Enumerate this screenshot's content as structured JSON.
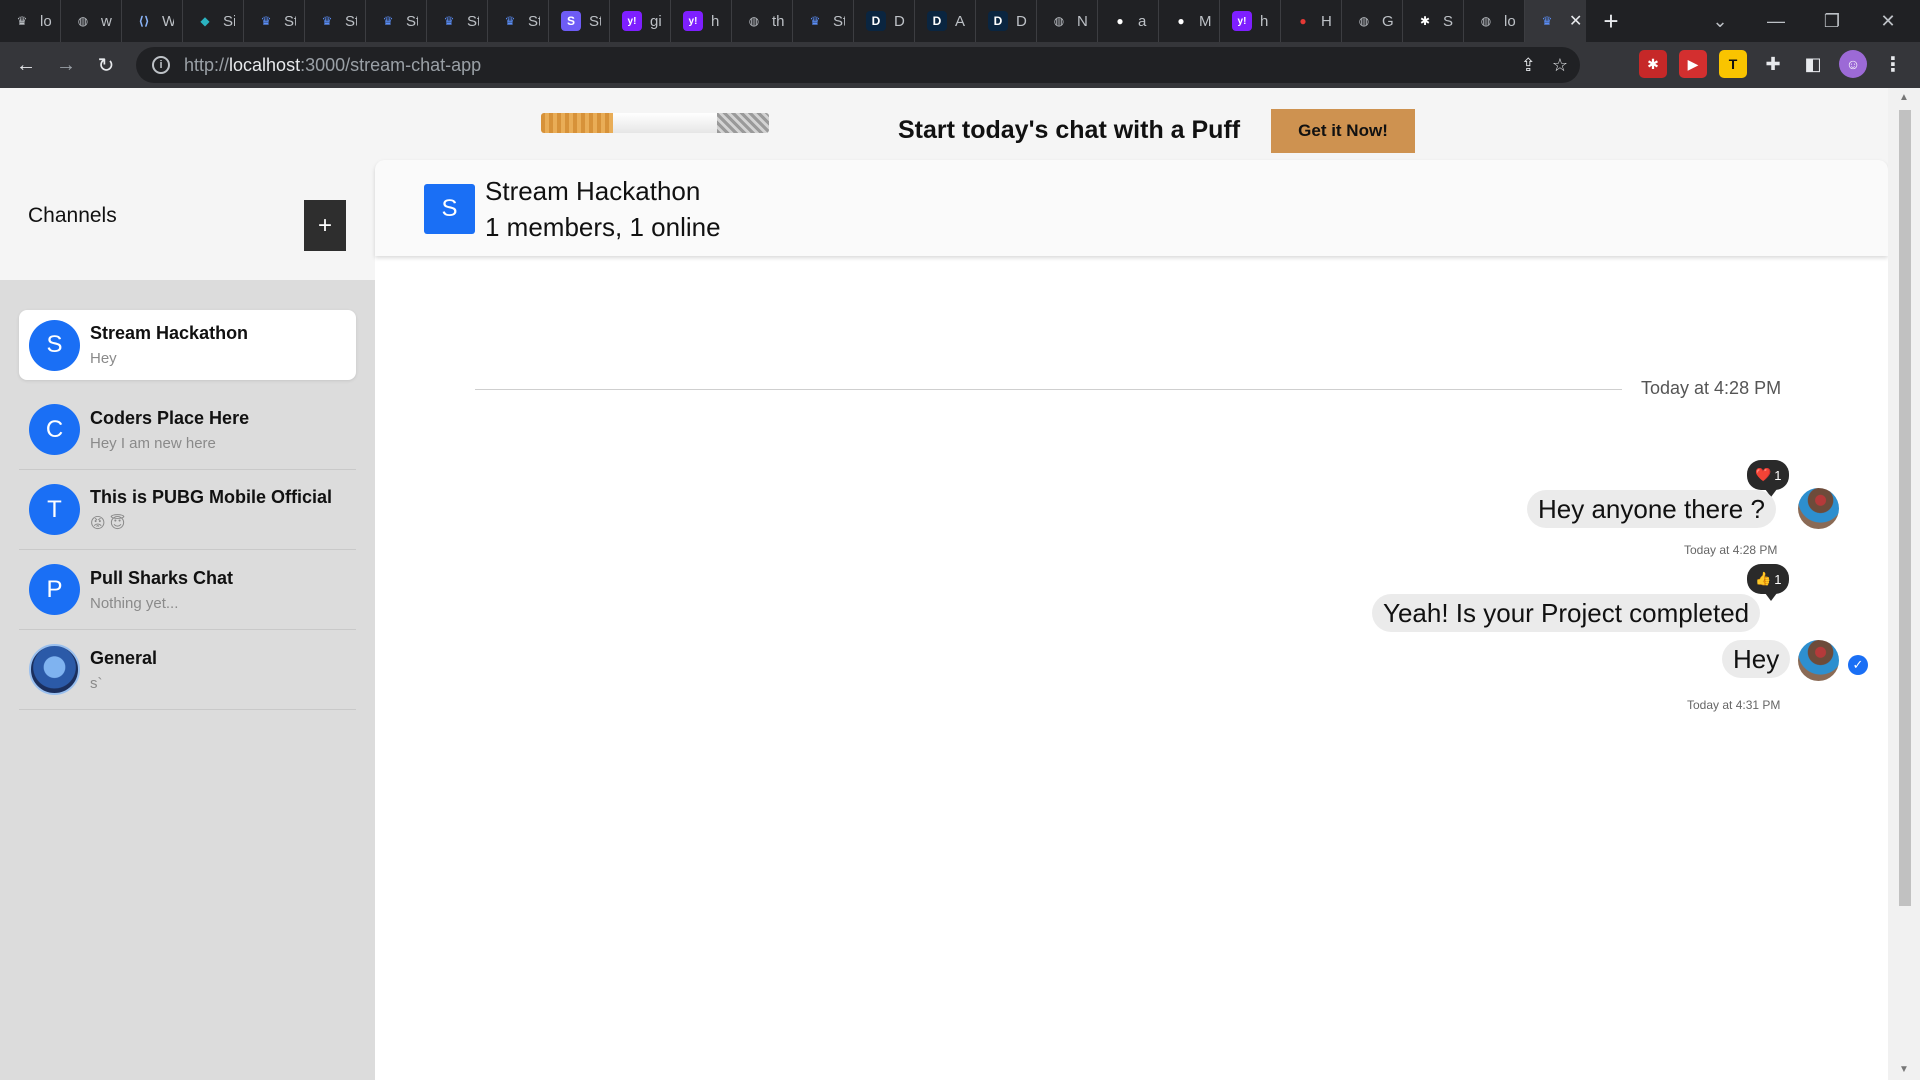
{
  "browser": {
    "tabs": [
      {
        "label": "lo",
        "icon": "vue-logo-icon",
        "color": "#bdc1c6"
      },
      {
        "label": "w",
        "icon": "globe-icon",
        "color": "#bdc1c6"
      },
      {
        "label": "W",
        "icon": "web-logo-icon",
        "color": "#8ab4f8"
      },
      {
        "label": "Si",
        "icon": "diamond-icon",
        "color": "#2bb3c0"
      },
      {
        "label": "St",
        "icon": "vue-logo-icon",
        "color": "#5b8ff9"
      },
      {
        "label": "St",
        "icon": "vue-logo-icon",
        "color": "#5b8ff9"
      },
      {
        "label": "St",
        "icon": "vue-logo-icon",
        "color": "#5b8ff9"
      },
      {
        "label": "St",
        "icon": "vue-logo-icon",
        "color": "#5b8ff9"
      },
      {
        "label": "St",
        "icon": "vue-logo-icon",
        "color": "#5b8ff9"
      },
      {
        "label": "St",
        "icon": "stream-s-icon",
        "color": "#6e5cf6"
      },
      {
        "label": "gi",
        "icon": "yahoo-icon",
        "color": "#7e1fff"
      },
      {
        "label": "h",
        "icon": "yahoo-icon",
        "color": "#7e1fff"
      },
      {
        "label": "th",
        "icon": "globe-icon",
        "color": "#bdc1c6"
      },
      {
        "label": "St",
        "icon": "vue-logo-icon",
        "color": "#5b8ff9"
      },
      {
        "label": "D",
        "icon": "d-letter-icon",
        "color": "#0a2540"
      },
      {
        "label": "A",
        "icon": "d-letter-icon",
        "color": "#0a2540"
      },
      {
        "label": "D",
        "icon": "d-letter-icon",
        "color": "#0a2540"
      },
      {
        "label": "N",
        "icon": "globe-icon",
        "color": "#bdc1c6"
      },
      {
        "label": "a",
        "icon": "github-icon",
        "color": "#ffffff"
      },
      {
        "label": "M",
        "icon": "github-icon",
        "color": "#ffffff"
      },
      {
        "label": "h",
        "icon": "yahoo-icon",
        "color": "#7e1fff"
      },
      {
        "label": "H",
        "icon": "record-icon",
        "color": "#e53935"
      },
      {
        "label": "G",
        "icon": "globe-icon",
        "color": "#bdc1c6"
      },
      {
        "label": "S",
        "icon": "gear-icon",
        "color": "#ffffff"
      },
      {
        "label": "lo",
        "icon": "globe-icon",
        "color": "#bdc1c6"
      }
    ],
    "active_tab_icon": "vue-logo-icon",
    "url_prefix": "http://",
    "url_host": "localhost",
    "url_rest": ":3000/stream-chat-app"
  },
  "banner": {
    "text": "Start today's chat with a Puff",
    "button": "Get it Now!"
  },
  "sidebar": {
    "title": "Channels",
    "add_label": "+",
    "channels": [
      {
        "initial": "S",
        "name": "Stream Hackathon",
        "preview": "Hey",
        "active": true
      },
      {
        "initial": "C",
        "name": "Coders Place Here",
        "preview": "Hey I am new here"
      },
      {
        "initial": "T",
        "name": "This is PUBG Mobile Official",
        "preview": "😡 😇"
      },
      {
        "initial": "P",
        "name": "Pull Sharks Chat",
        "preview": "Nothing yet..."
      },
      {
        "initial": "",
        "name": "General",
        "preview": "s`",
        "image_avatar": true
      }
    ]
  },
  "channel": {
    "initial": "S",
    "name": "Stream Hackathon",
    "subtitle": "1 members, 1 online"
  },
  "messages": {
    "date_separator": "Today at 4:28 PM",
    "items": [
      {
        "text": "Hey anyone there ?",
        "reaction": "❤️",
        "reaction_count": "1",
        "timestamp": "Today at 4:28 PM"
      },
      {
        "text": "Yeah! Is your Project completed",
        "reaction": "👍",
        "reaction_count": "1"
      },
      {
        "text": "Hey",
        "timestamp": "Today at 4:31 PM"
      }
    ]
  },
  "colors": {
    "accent": "#1a6ff5",
    "banner_button": "#ce9250",
    "sidebar_bg": "#dcdcdc"
  }
}
